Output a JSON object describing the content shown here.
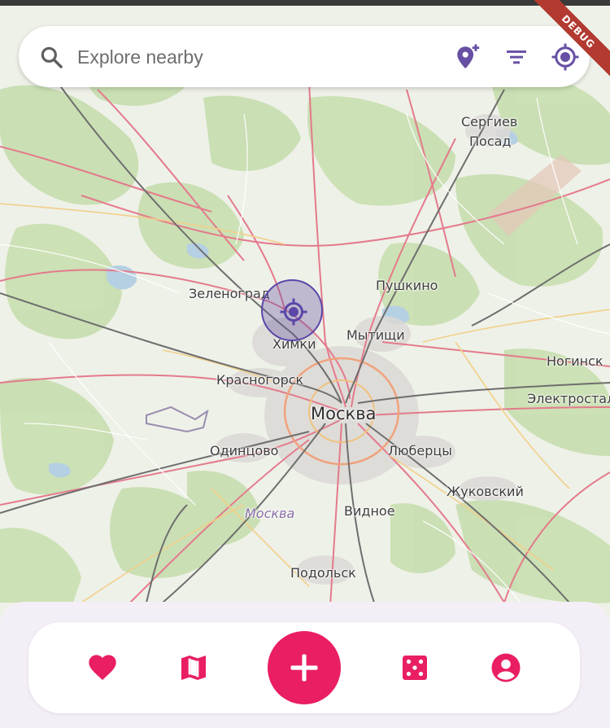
{
  "search": {
    "placeholder": "Explore nearby"
  },
  "toolbar": {
    "icons": [
      "search-icon",
      "add-location-icon",
      "filter-icon",
      "my-location-icon"
    ]
  },
  "debug_banner": "DEBUG",
  "map": {
    "labels": [
      {
        "text": "Сергиев"
      },
      {
        "text": "Посад"
      },
      {
        "text": "Зеленоград"
      },
      {
        "text": "Пушкино"
      },
      {
        "text": "Мытищи"
      },
      {
        "text": "Химки"
      },
      {
        "text": "Ногинск"
      },
      {
        "text": "Красногорск"
      },
      {
        "text": "Электросталь"
      },
      {
        "text": "Москва"
      },
      {
        "text": "Одинцово"
      },
      {
        "text": "Люберцы"
      },
      {
        "text": "Жуковский"
      },
      {
        "text": "Москва"
      },
      {
        "text": "Видное"
      },
      {
        "text": "Подольск"
      }
    ]
  },
  "bottom_nav": {
    "items": [
      "favorites-icon",
      "map-icon",
      "add-icon",
      "dice-icon",
      "account-icon"
    ]
  },
  "colors": {
    "accent": "#e91e63",
    "primary": "#6750a4",
    "panel": "#f4eef7",
    "map_base": "#eef1e8"
  }
}
